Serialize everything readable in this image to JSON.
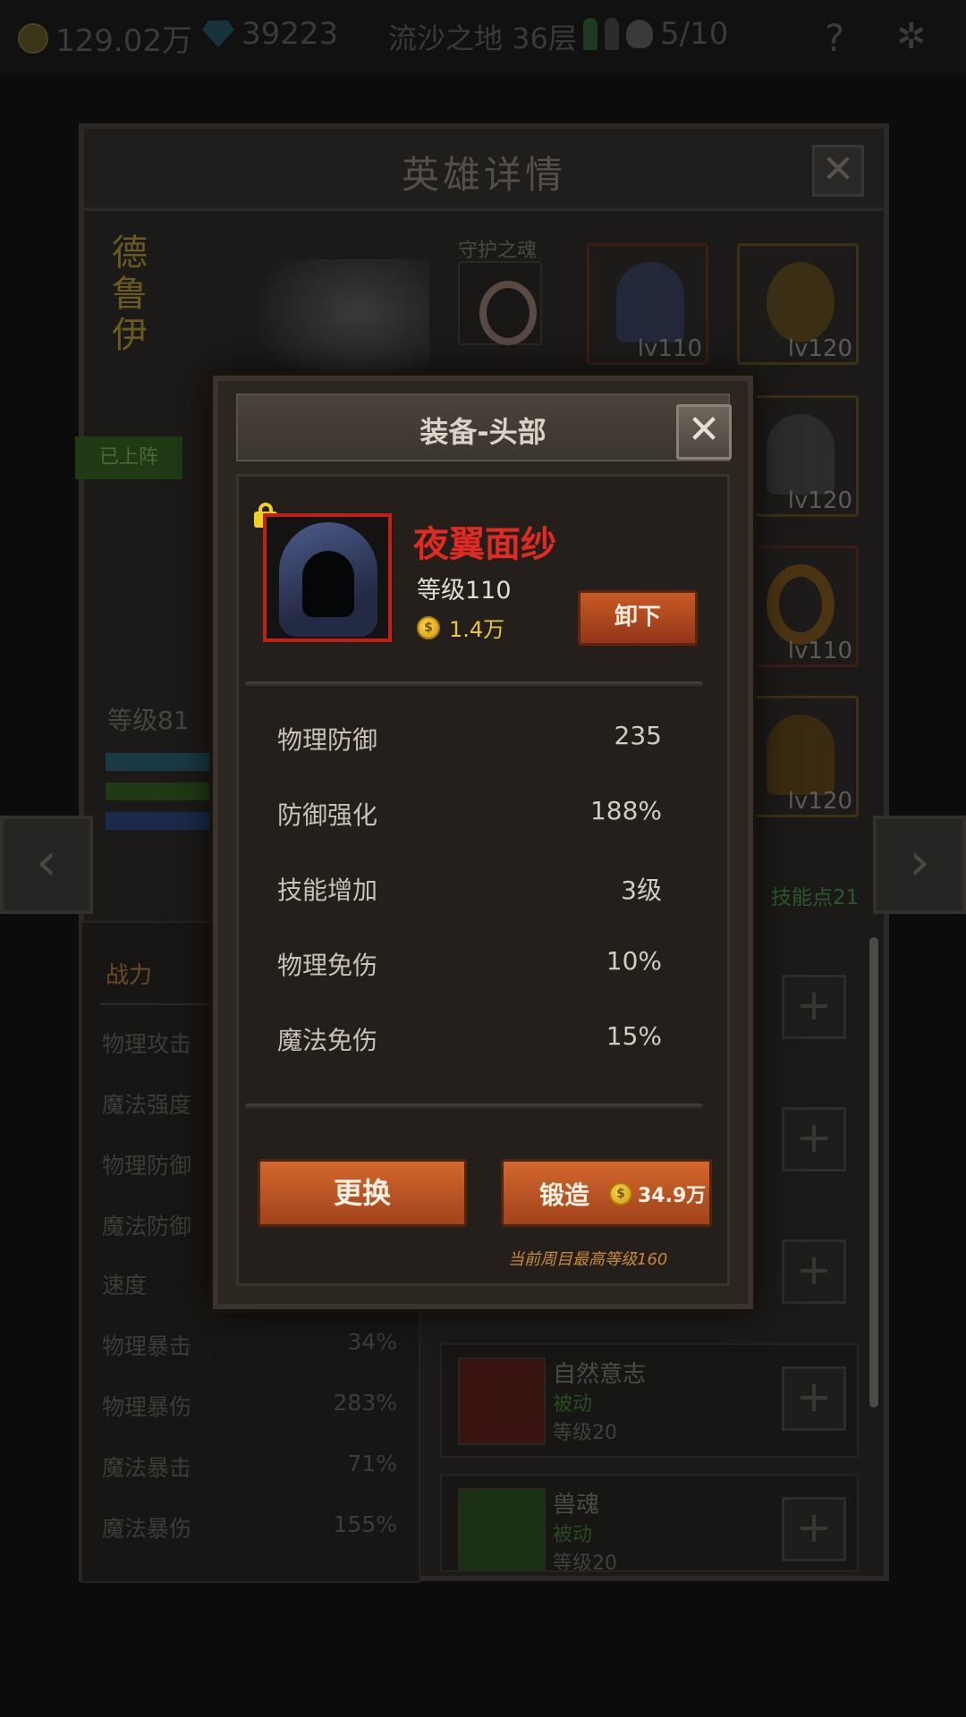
{
  "topbar": {
    "gold": "129.02万",
    "gems": "39223",
    "location": "流沙之地 36层",
    "keys": "5/10",
    "help": "?"
  },
  "hero_panel": {
    "title": "英雄详情",
    "close": "✕",
    "hero_name": [
      "德",
      "鲁",
      "伊"
    ],
    "guard_label": "守护之魂",
    "deployed_label": "已上阵",
    "level": "等级81",
    "skill_points": "技能点21",
    "equipment": [
      {
        "slot": "head",
        "level": "lv110",
        "rarity": "red"
      },
      {
        "slot": "accessory",
        "level": "lv120",
        "rarity": "gold"
      },
      {
        "slot": "armor",
        "level": "lv120",
        "rarity": "gold"
      },
      {
        "slot": "ring",
        "level": "lv110",
        "rarity": "red"
      },
      {
        "slot": "offhand",
        "level": "lv120",
        "rarity": "gold"
      }
    ],
    "stats_header": "战力",
    "stats": [
      {
        "label": "物理攻击",
        "value": ""
      },
      {
        "label": "魔法强度",
        "value": ""
      },
      {
        "label": "物理防御",
        "value": ""
      },
      {
        "label": "魔法防御",
        "value": ""
      },
      {
        "label": "速度",
        "value": ""
      },
      {
        "label": "物理暴击",
        "value": "34%"
      },
      {
        "label": "物理暴伤",
        "value": "283%"
      },
      {
        "label": "魔法暴击",
        "value": "71%"
      },
      {
        "label": "魔法暴伤",
        "value": "155%"
      }
    ],
    "skills": [
      {
        "name": "自然意志",
        "type": "被动",
        "level": "等级20"
      },
      {
        "name": "兽魂",
        "type": "被动",
        "level": "等级20"
      }
    ],
    "prev_arrow": "‹",
    "next_arrow": "›"
  },
  "modal": {
    "title": "装备-头部",
    "close": "✕",
    "item": {
      "name": "夜翼面纱",
      "level": "等级110",
      "price": "1.4万",
      "icon": "hood-icon",
      "locked": true
    },
    "unequip_label": "卸下",
    "attributes": [
      {
        "label": "物理防御",
        "value": "235"
      },
      {
        "label": "防御强化",
        "value": "188%"
      },
      {
        "label": "技能增加",
        "value": "3级"
      },
      {
        "label": "物理免伤",
        "value": "10%"
      },
      {
        "label": "魔法免伤",
        "value": "15%"
      }
    ],
    "replace_label": "更换",
    "forge_label": "锻造",
    "forge_cost": "34.9万",
    "max_note": "当前周目最高等级160"
  },
  "colors": {
    "item_name": "#e02a22",
    "button_orange": "#c75a24",
    "gold": "#e6c54a"
  }
}
